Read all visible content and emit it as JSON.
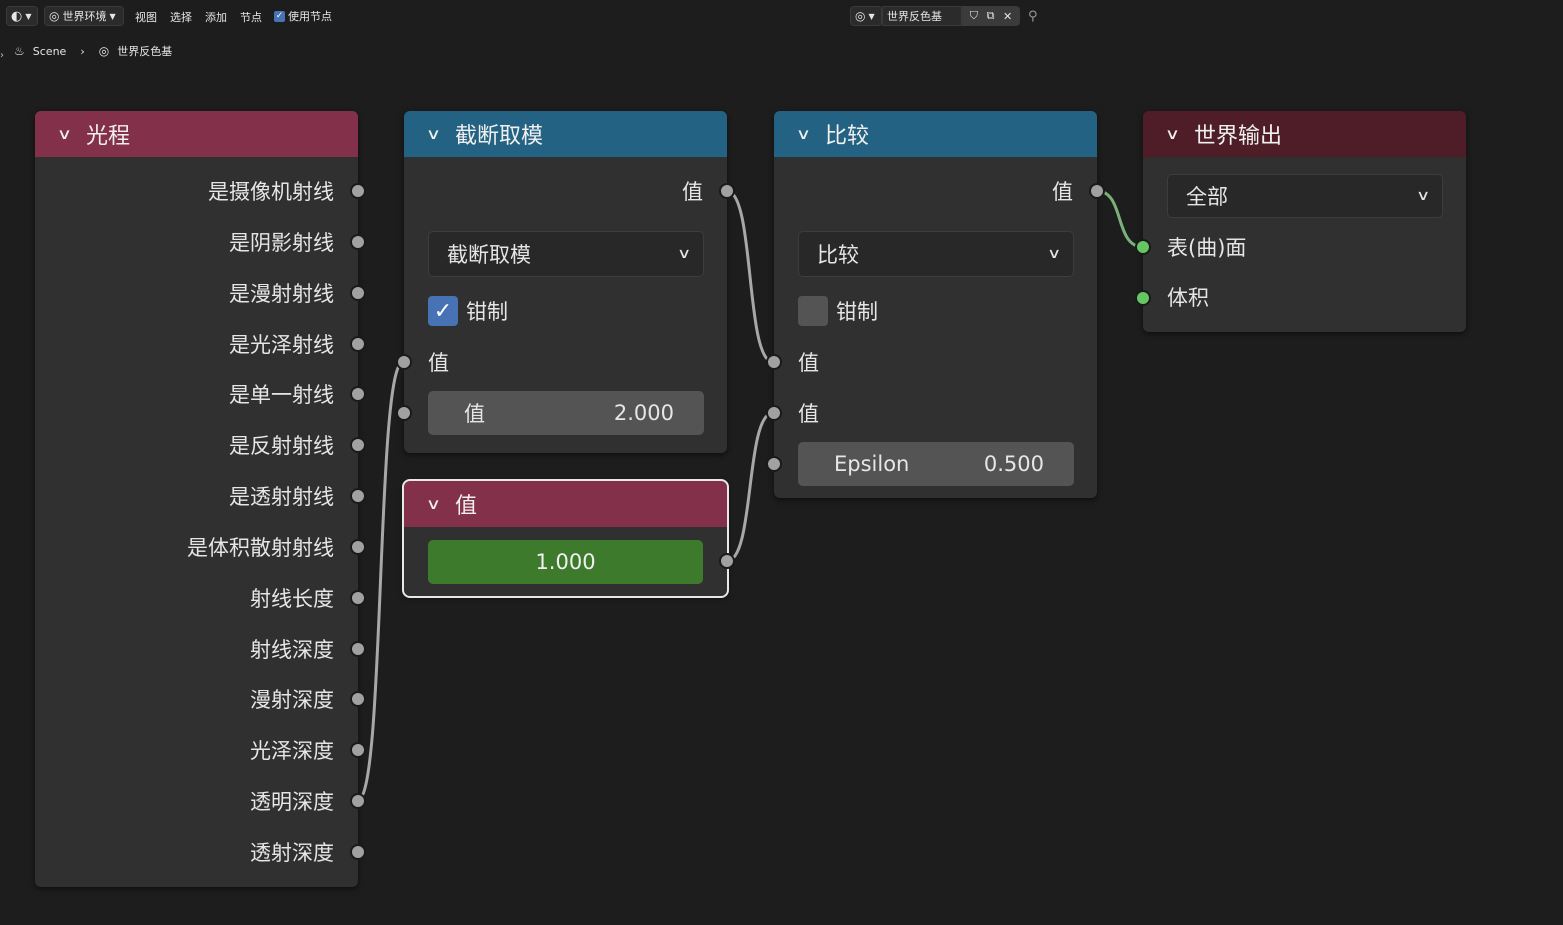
{
  "header": {
    "world_type": "世界环境",
    "menus": [
      "视图",
      "选择",
      "添加",
      "节点"
    ],
    "use_nodes_label": "使用节点",
    "use_nodes_checked": true,
    "datablock_name": "世界反色基"
  },
  "breadcrumb": {
    "scene": "Scene",
    "world": "世界反色基"
  },
  "nodes": {
    "light_path": {
      "title": "光程",
      "header_color": "#83314a",
      "outputs": [
        "是摄像机射线",
        "是阴影射线",
        "是漫射射线",
        "是光泽射线",
        "是单一射线",
        "是反射射线",
        "是透射射线",
        "是体积散射射线",
        "射线长度",
        "射线深度",
        "漫射深度",
        "光泽深度",
        "透明深度",
        "透射深度"
      ]
    },
    "truncated_modulo": {
      "title": "截断取模",
      "header_color": "#246283",
      "output_label": "值",
      "operation": "截断取模",
      "clamp_label": "钳制",
      "clamp_checked": true,
      "input1_label": "值",
      "input2_label": "值",
      "input2_value": "2.000"
    },
    "value": {
      "title": "值",
      "header_color": "#83314a",
      "value": "1.000"
    },
    "compare": {
      "title": "比较",
      "header_color": "#246283",
      "output_label": "值",
      "operation": "比较",
      "clamp_label": "钳制",
      "clamp_checked": false,
      "input1_label": "值",
      "input2_label": "值",
      "epsilon_label": "Epsilon",
      "epsilon_value": "0.500"
    },
    "world_output": {
      "title": "世界输出",
      "header_color": "#4e1d28",
      "target": "全部",
      "surface_label": "表(曲)面",
      "volume_label": "体积"
    }
  },
  "colors": {
    "background": "#1d1d1d",
    "node_body": "#303030",
    "socket_float": "#a1a1a1",
    "socket_shader": "#63c763",
    "accent": "#4772b3"
  }
}
